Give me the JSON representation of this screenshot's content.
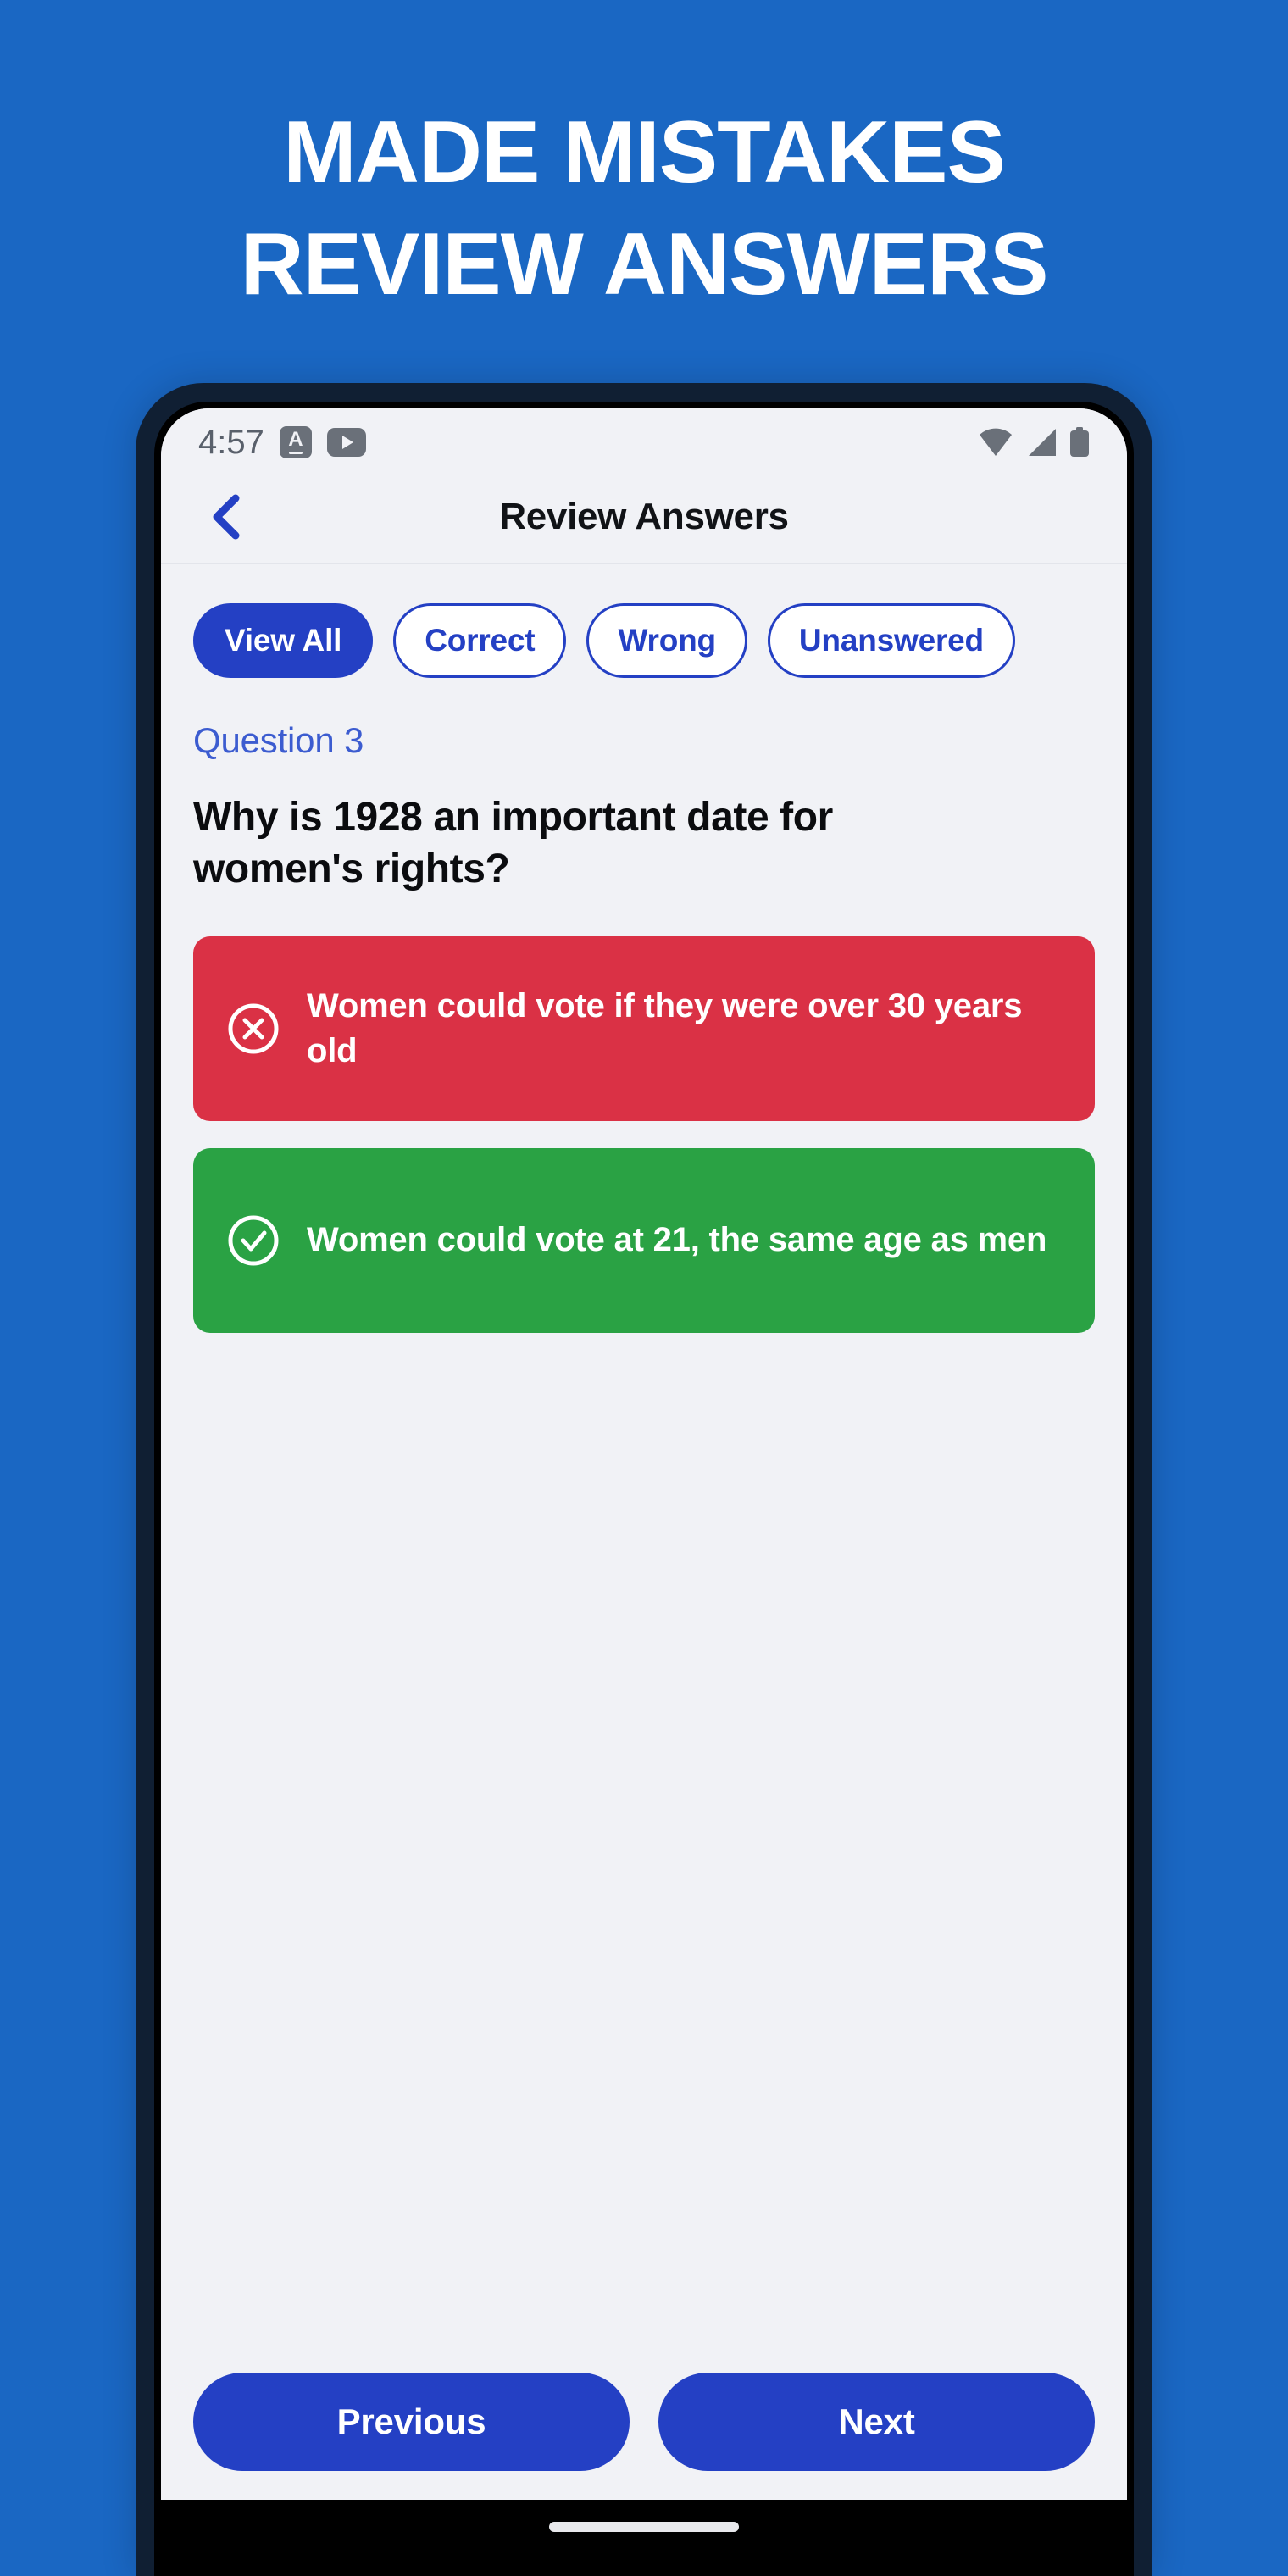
{
  "promo": {
    "line1": "MADE MISTAKES",
    "line2": "REVIEW ANSWERS"
  },
  "colors": {
    "background_blue": "#1A67C3",
    "brand_blue": "#2440C4",
    "accent_blue": "#3C5CD0",
    "wrong_red": "#DA3145",
    "correct_green": "#2AA244",
    "screen_bg": "#F1F2F6",
    "bezel": "#101F33"
  },
  "statusbar": {
    "time": "4:57",
    "translate_letter": "A",
    "icons": [
      "translate-icon",
      "youtube-icon",
      "wifi-icon",
      "cellular-signal-icon",
      "battery-icon"
    ]
  },
  "appbar": {
    "title": "Review Answers",
    "back_icon": "chevron-left-icon"
  },
  "filters": [
    {
      "label": "View All",
      "active": true
    },
    {
      "label": "Correct",
      "active": false
    },
    {
      "label": "Wrong",
      "active": false
    },
    {
      "label": "Unanswered",
      "active": false
    }
  ],
  "question": {
    "number_label": "Question 3",
    "text": "Why is 1928 an important date for women's rights?",
    "answers": [
      {
        "text": "Women could vote if they were over 30 years old",
        "state": "wrong",
        "icon": "circle-x-icon"
      },
      {
        "text": "Women could vote at 21, the same age as men",
        "state": "correct",
        "icon": "circle-check-icon"
      }
    ]
  },
  "navigation": {
    "previous_label": "Previous",
    "next_label": "Next"
  }
}
